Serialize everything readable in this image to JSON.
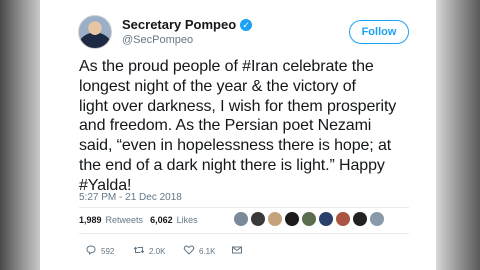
{
  "user": {
    "display_name": "Secretary Pompeo",
    "handle": "@SecPompeo",
    "verified_glyph": "✓"
  },
  "follow_label": "Follow",
  "tweet_lines": [
    "As the proud people of #Iran celebrate the",
    "longest night of the year & the victory of",
    "light over darkness, I wish for them prosperity",
    "and freedom. As the Persian poet Nezami",
    "said, “even in hopelessness there is hope; at",
    "the end of a dark night there is light.” Happy",
    "#Yalda!"
  ],
  "timestamp": "5:27 PM - 21 Dec 2018",
  "stats": {
    "retweets_count": "1,989",
    "retweets_label": "Retweets",
    "likes_count": "6,062",
    "likes_label": "Likes"
  },
  "liker_colors": [
    "#7a8a9a",
    "#3a3a3a",
    "#c4a27a",
    "#1b1b1b",
    "#5a6d4e",
    "#2b3f6b",
    "#aa5544",
    "#222222",
    "#8899aa"
  ],
  "actions": {
    "reply_count": "592",
    "retweet_count": "2.0K",
    "like_count": "6.1K"
  },
  "icons": {
    "chevron": "chevron-down-icon",
    "reply": "reply-icon",
    "retweet": "retweet-icon",
    "like": "heart-icon",
    "dm": "envelope-icon"
  }
}
